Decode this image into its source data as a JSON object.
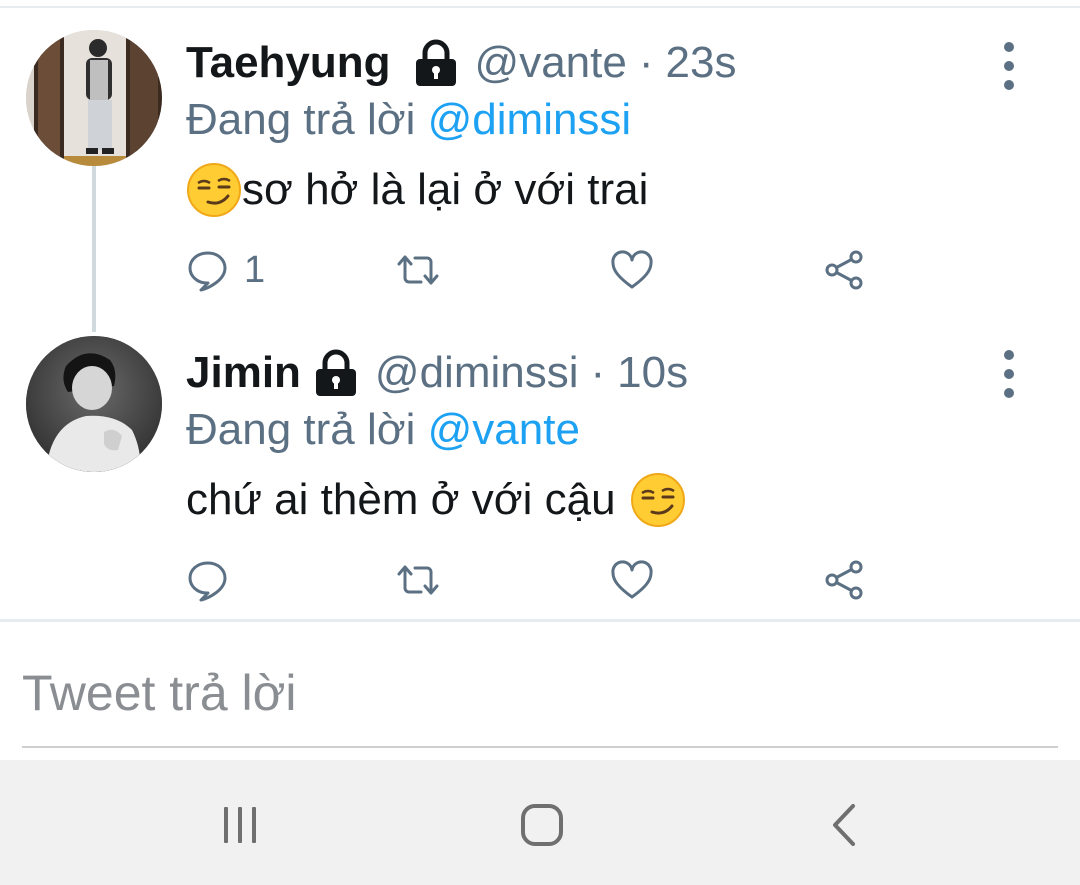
{
  "tweets": [
    {
      "display_name": "Taehyung",
      "handle": "@vante",
      "separator": "·",
      "time": "23s",
      "replying_prefix": "Đang trả lời",
      "replying_to": "@diminssi",
      "text": "sơ hở là lại ở với trai",
      "emoji": "smirking-face",
      "reply_count": "1",
      "protected": true
    },
    {
      "display_name": "Jimin",
      "handle": "@diminssi",
      "separator": "·",
      "time": "10s",
      "replying_prefix": "Đang trả lời",
      "replying_to": "@vante",
      "text": "chứ ai thèm ở với cậu",
      "emoji": "smirking-face",
      "reply_count": "",
      "protected": true
    }
  ],
  "compose": {
    "placeholder": "Tweet trả lời"
  },
  "navbar": {
    "items": [
      "recents-icon",
      "home-icon",
      "back-icon"
    ]
  },
  "colors": {
    "mention": "#1da1f2",
    "secondary_text": "#5b7083",
    "navbar_bg": "#f1f1f1"
  }
}
